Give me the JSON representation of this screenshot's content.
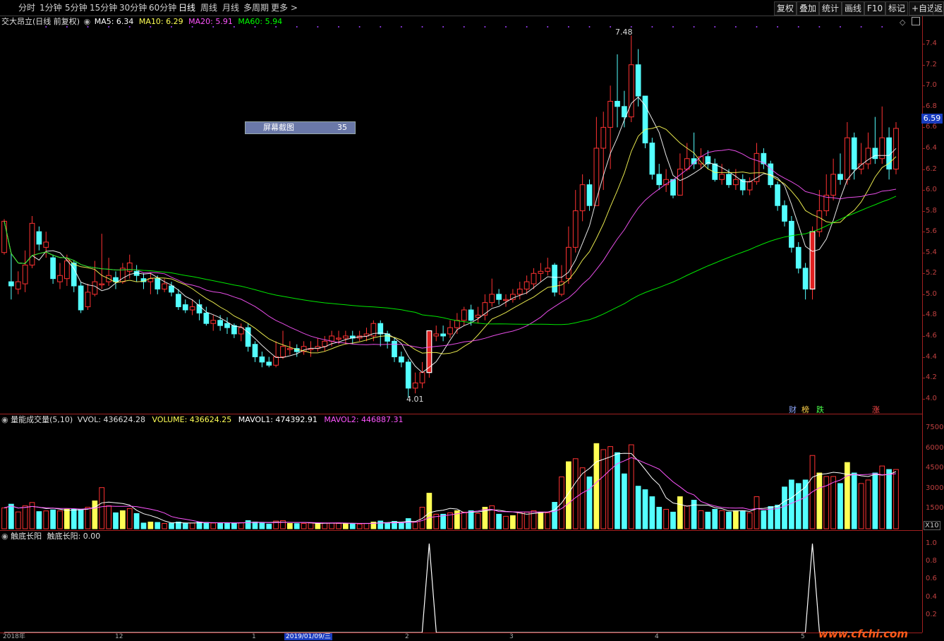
{
  "toolbar": {
    "periods": [
      "分时",
      "1分钟",
      "5分钟",
      "15分钟",
      "30分钟",
      "60分钟",
      "日线",
      "周线",
      "月线",
      "多周期",
      "更多 >"
    ],
    "active_period": "日线",
    "right_buttons": [
      "复权",
      "叠加",
      "统计",
      "画线",
      "F10",
      "标记",
      "+自选",
      "返"
    ]
  },
  "main_info": {
    "stock_label": "交大昂立(日线 前复权)",
    "ma5": "MA5: 6.34",
    "ma10": "MA10: 6.29",
    "ma20": "MA20: 5.91",
    "ma60": "MA60: 5.94"
  },
  "price_axis": [
    "7.4",
    "7.2",
    "7.0",
    "6.8",
    "6.6",
    "6.4",
    "6.2",
    "6.0",
    "5.8",
    "5.6",
    "5.4",
    "5.2",
    "5.0",
    "4.8",
    "4.6",
    "4.4",
    "4.2",
    "4.0"
  ],
  "current_price": "6.59",
  "annotations": {
    "high": "7.48",
    "low": "4.01"
  },
  "screenshot_tag": {
    "label": "屏幕截图",
    "count": "35"
  },
  "event_marks": [
    "财",
    "榜",
    "跌",
    "涨"
  ],
  "volume_info": {
    "title": "量能成交量(5,10)",
    "vvol": "VVOL: 436624.28",
    "volume": "VOLUME: 436624.25",
    "mavol1": "MAVOL1: 474392.91",
    "mavol2": "MAVOL2: 446887.31"
  },
  "volume_axis": [
    "7500",
    "6000",
    "4500",
    "3000",
    "1500"
  ],
  "volume_unit": "X10",
  "indicator_info": {
    "title": "触底长阳",
    "value": "触底长阳: 0.00"
  },
  "indicator_axis": [
    "1.0",
    "0.8",
    "0.6",
    "0.4",
    "0.2"
  ],
  "date_axis": [
    "2018年",
    "12",
    "1",
    "2019/01/09/三",
    "2",
    "3",
    "4",
    "5"
  ],
  "watermark": "www.cfchi.com",
  "colors": {
    "up": "#ff3232",
    "down": "#54ffff",
    "ma5": "#ffffff",
    "ma10": "#ffff55",
    "ma20": "#ff55ff",
    "ma60": "#00ff00",
    "axis": "#a02020"
  },
  "chart_data": {
    "type": "candlestick",
    "price_range": [
      3.95,
      7.55
    ],
    "candles": [
      [
        5.4,
        5.7,
        5.72,
        5.38
      ],
      [
        5.12,
        5.08,
        5.4,
        4.95
      ],
      [
        5.05,
        5.12,
        5.22,
        5.0
      ],
      [
        5.1,
        5.28,
        5.42,
        5.02
      ],
      [
        5.28,
        5.68,
        5.75,
        5.25
      ],
      [
        5.6,
        5.48,
        5.65,
        5.42
      ],
      [
        5.45,
        5.5,
        5.6,
        5.35
      ],
      [
        5.35,
        5.15,
        5.38,
        5.1
      ],
      [
        5.12,
        5.18,
        5.3,
        5.05
      ],
      [
        5.15,
        5.32,
        5.38,
        5.08
      ],
      [
        5.3,
        5.08,
        5.32,
        5.02
      ],
      [
        5.08,
        4.85,
        5.12,
        4.82
      ],
      [
        4.88,
        5.02,
        5.1,
        4.85
      ],
      [
        5.0,
        5.12,
        5.32,
        4.98
      ],
      [
        5.1,
        5.1,
        5.58,
        5.05
      ],
      [
        5.12,
        5.18,
        5.35,
        5.08
      ],
      [
        5.16,
        5.12,
        5.22,
        5.05
      ],
      [
        5.12,
        5.25,
        5.3,
        5.1
      ],
      [
        5.22,
        5.3,
        5.38,
        5.15
      ],
      [
        5.22,
        5.18,
        5.28,
        5.12
      ],
      [
        5.15,
        5.12,
        5.2,
        5.05
      ],
      [
        5.12,
        5.15,
        5.2,
        5.0
      ],
      [
        5.15,
        5.05,
        5.18,
        5.0
      ],
      [
        5.05,
        5.1,
        5.15,
        5.02
      ],
      [
        5.08,
        5.02,
        5.12,
        4.98
      ],
      [
        5.0,
        4.88,
        5.05,
        4.85
      ],
      [
        4.9,
        4.85,
        4.95,
        4.82
      ],
      [
        4.85,
        4.88,
        4.95,
        4.8
      ],
      [
        4.9,
        4.82,
        4.95,
        4.75
      ],
      [
        4.82,
        4.72,
        4.88,
        4.7
      ],
      [
        4.72,
        4.75,
        4.8,
        4.65
      ],
      [
        4.75,
        4.7,
        4.8,
        4.65
      ],
      [
        4.72,
        4.68,
        4.78,
        4.62
      ],
      [
        4.7,
        4.62,
        4.72,
        4.58
      ],
      [
        4.62,
        4.68,
        4.72,
        4.55
      ],
      [
        4.68,
        4.5,
        4.72,
        4.45
      ],
      [
        4.52,
        4.4,
        4.55,
        4.35
      ],
      [
        4.4,
        4.35,
        4.45,
        4.3
      ],
      [
        4.35,
        4.32,
        4.4,
        4.3
      ],
      [
        4.32,
        4.4,
        4.55,
        4.3
      ],
      [
        4.4,
        4.5,
        4.65,
        4.38
      ],
      [
        4.48,
        4.48,
        4.55,
        4.42
      ],
      [
        4.48,
        4.45,
        4.52,
        4.4
      ],
      [
        4.45,
        4.5,
        4.55,
        4.42
      ],
      [
        4.48,
        4.48,
        4.55,
        4.4
      ],
      [
        4.48,
        4.5,
        4.58,
        4.45
      ],
      [
        4.5,
        4.55,
        4.6,
        4.45
      ],
      [
        4.55,
        4.6,
        4.65,
        4.5
      ],
      [
        4.58,
        4.58,
        4.65,
        4.52
      ],
      [
        4.58,
        4.6,
        4.65,
        4.52
      ],
      [
        4.6,
        4.58,
        4.65,
        4.52
      ],
      [
        4.58,
        4.6,
        4.65,
        4.55
      ],
      [
        4.6,
        4.62,
        4.68,
        4.55
      ],
      [
        4.6,
        4.72,
        4.75,
        4.55
      ],
      [
        4.72,
        4.62,
        4.75,
        4.5
      ],
      [
        4.62,
        4.55,
        4.65,
        4.48
      ],
      [
        4.55,
        4.4,
        4.58,
        4.35
      ],
      [
        4.4,
        4.35,
        4.45,
        4.3
      ],
      [
        4.35,
        4.1,
        4.38,
        4.01
      ],
      [
        4.1,
        4.15,
        4.25,
        4.05
      ],
      [
        4.15,
        4.25,
        4.35,
        4.1
      ],
      [
        4.25,
        4.65,
        4.65,
        4.2
      ],
      [
        4.6,
        4.62,
        4.7,
        4.55
      ],
      [
        4.62,
        4.6,
        4.7,
        4.55
      ],
      [
        4.62,
        4.68,
        4.75,
        4.58
      ],
      [
        4.68,
        4.75,
        4.82,
        4.62
      ],
      [
        4.75,
        4.85,
        4.88,
        4.7
      ],
      [
        4.85,
        4.75,
        4.9,
        4.7
      ],
      [
        4.78,
        4.8,
        4.88,
        4.72
      ],
      [
        4.8,
        4.92,
        5.0,
        4.75
      ],
      [
        4.92,
        5.0,
        5.15,
        4.88
      ],
      [
        5.0,
        4.95,
        5.05,
        4.9
      ],
      [
        4.95,
        4.95,
        5.0,
        4.88
      ],
      [
        4.95,
        5.0,
        5.05,
        4.92
      ],
      [
        5.0,
        5.05,
        5.12,
        4.95
      ],
      [
        5.05,
        5.12,
        5.18,
        5.0
      ],
      [
        5.1,
        5.2,
        5.25,
        5.05
      ],
      [
        5.2,
        5.22,
        5.3,
        5.12
      ],
      [
        5.22,
        5.25,
        5.35,
        5.18
      ],
      [
        5.28,
        5.02,
        5.3,
        4.98
      ],
      [
        5.0,
        5.12,
        5.28,
        4.98
      ],
      [
        5.15,
        5.45,
        5.65,
        5.1
      ],
      [
        5.45,
        5.8,
        6.0,
        5.4
      ],
      [
        5.8,
        6.05,
        6.15,
        5.7
      ],
      [
        6.05,
        5.85,
        6.1,
        5.8
      ],
      [
        5.85,
        6.4,
        6.7,
        5.85
      ],
      [
        6.4,
        6.6,
        6.75,
        6.0
      ],
      [
        6.6,
        6.85,
        7.0,
        6.2
      ],
      [
        6.85,
        6.8,
        7.3,
        6.6
      ],
      [
        6.8,
        6.7,
        6.95,
        6.6
      ],
      [
        6.7,
        7.2,
        7.48,
        6.65
      ],
      [
        7.2,
        6.9,
        7.35,
        6.8
      ],
      [
        6.9,
        6.45,
        6.9,
        6.4
      ],
      [
        6.45,
        6.15,
        6.5,
        6.1
      ],
      [
        6.15,
        6.05,
        6.25,
        6.0
      ],
      [
        6.05,
        6.1,
        6.2,
        5.98
      ],
      [
        6.1,
        5.95,
        6.1,
        5.92
      ],
      [
        5.95,
        6.2,
        6.35,
        5.95
      ],
      [
        6.2,
        6.3,
        6.45,
        6.18
      ],
      [
        6.3,
        6.25,
        6.55,
        6.2
      ],
      [
        6.25,
        6.32,
        6.4,
        6.2
      ],
      [
        6.32,
        6.25,
        6.38,
        6.2
      ],
      [
        6.25,
        6.1,
        6.3,
        6.08
      ],
      [
        6.1,
        6.15,
        6.25,
        6.05
      ],
      [
        6.15,
        6.05,
        6.2,
        6.02
      ],
      [
        6.05,
        6.1,
        6.2,
        6.0
      ],
      [
        6.1,
        6.0,
        6.15,
        5.95
      ],
      [
        6.0,
        6.08,
        6.12,
        5.95
      ],
      [
        6.08,
        6.35,
        6.45,
        6.05
      ],
      [
        6.35,
        6.25,
        6.4,
        6.2
      ],
      [
        6.25,
        6.05,
        6.28,
        6.02
      ],
      [
        6.05,
        5.85,
        6.08,
        5.8
      ],
      [
        5.85,
        5.7,
        5.9,
        5.65
      ],
      [
        5.7,
        5.45,
        5.75,
        5.4
      ],
      [
        5.45,
        5.25,
        5.5,
        5.2
      ],
      [
        5.25,
        5.05,
        5.3,
        4.95
      ],
      [
        5.05,
        5.6,
        5.65,
        4.95
      ],
      [
        5.6,
        5.8,
        6.0,
        5.55
      ],
      [
        5.8,
        5.95,
        6.15,
        5.75
      ],
      [
        5.95,
        6.15,
        6.3,
        5.9
      ],
      [
        6.15,
        6.1,
        6.35,
        6.05
      ],
      [
        6.1,
        6.5,
        6.65,
        6.05
      ],
      [
        6.5,
        6.2,
        6.55,
        6.1
      ],
      [
        6.2,
        6.25,
        6.45,
        6.15
      ],
      [
        6.25,
        6.4,
        6.55,
        6.2
      ],
      [
        6.4,
        6.3,
        6.7,
        6.25
      ],
      [
        6.3,
        6.5,
        6.8,
        6.25
      ],
      [
        6.5,
        6.2,
        6.6,
        6.1
      ],
      [
        6.2,
        6.59,
        6.65,
        6.15
      ]
    ]
  }
}
